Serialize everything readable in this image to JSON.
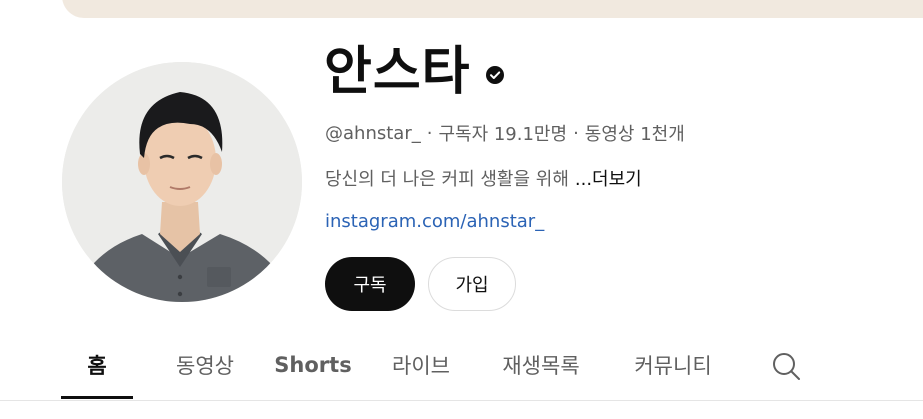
{
  "channel": {
    "name": "안스타",
    "handle": "@ahnstar_",
    "subscribers": "구독자 19.1만명",
    "videos": "동영상 1천개",
    "separator": "·",
    "description": "당신의 더 나은 커피 생활을 위해",
    "more_label": "...더보기",
    "link": "instagram.com/ahnstar_"
  },
  "buttons": {
    "subscribe": "구독",
    "join": "가입"
  },
  "tabs": [
    {
      "label": "홈",
      "active": true
    },
    {
      "label": "동영상"
    },
    {
      "label": "Shorts"
    },
    {
      "label": "라이브"
    },
    {
      "label": "재생목록"
    },
    {
      "label": "커뮤니티"
    }
  ],
  "icons": {
    "verified": "verified-check-icon",
    "search": "search-icon"
  },
  "colors": {
    "banner": "#f1e9df",
    "text_primary": "#0f0f0f",
    "text_secondary": "#606060",
    "link": "#2b63b5",
    "subscribe_bg": "#0f0f0f"
  }
}
